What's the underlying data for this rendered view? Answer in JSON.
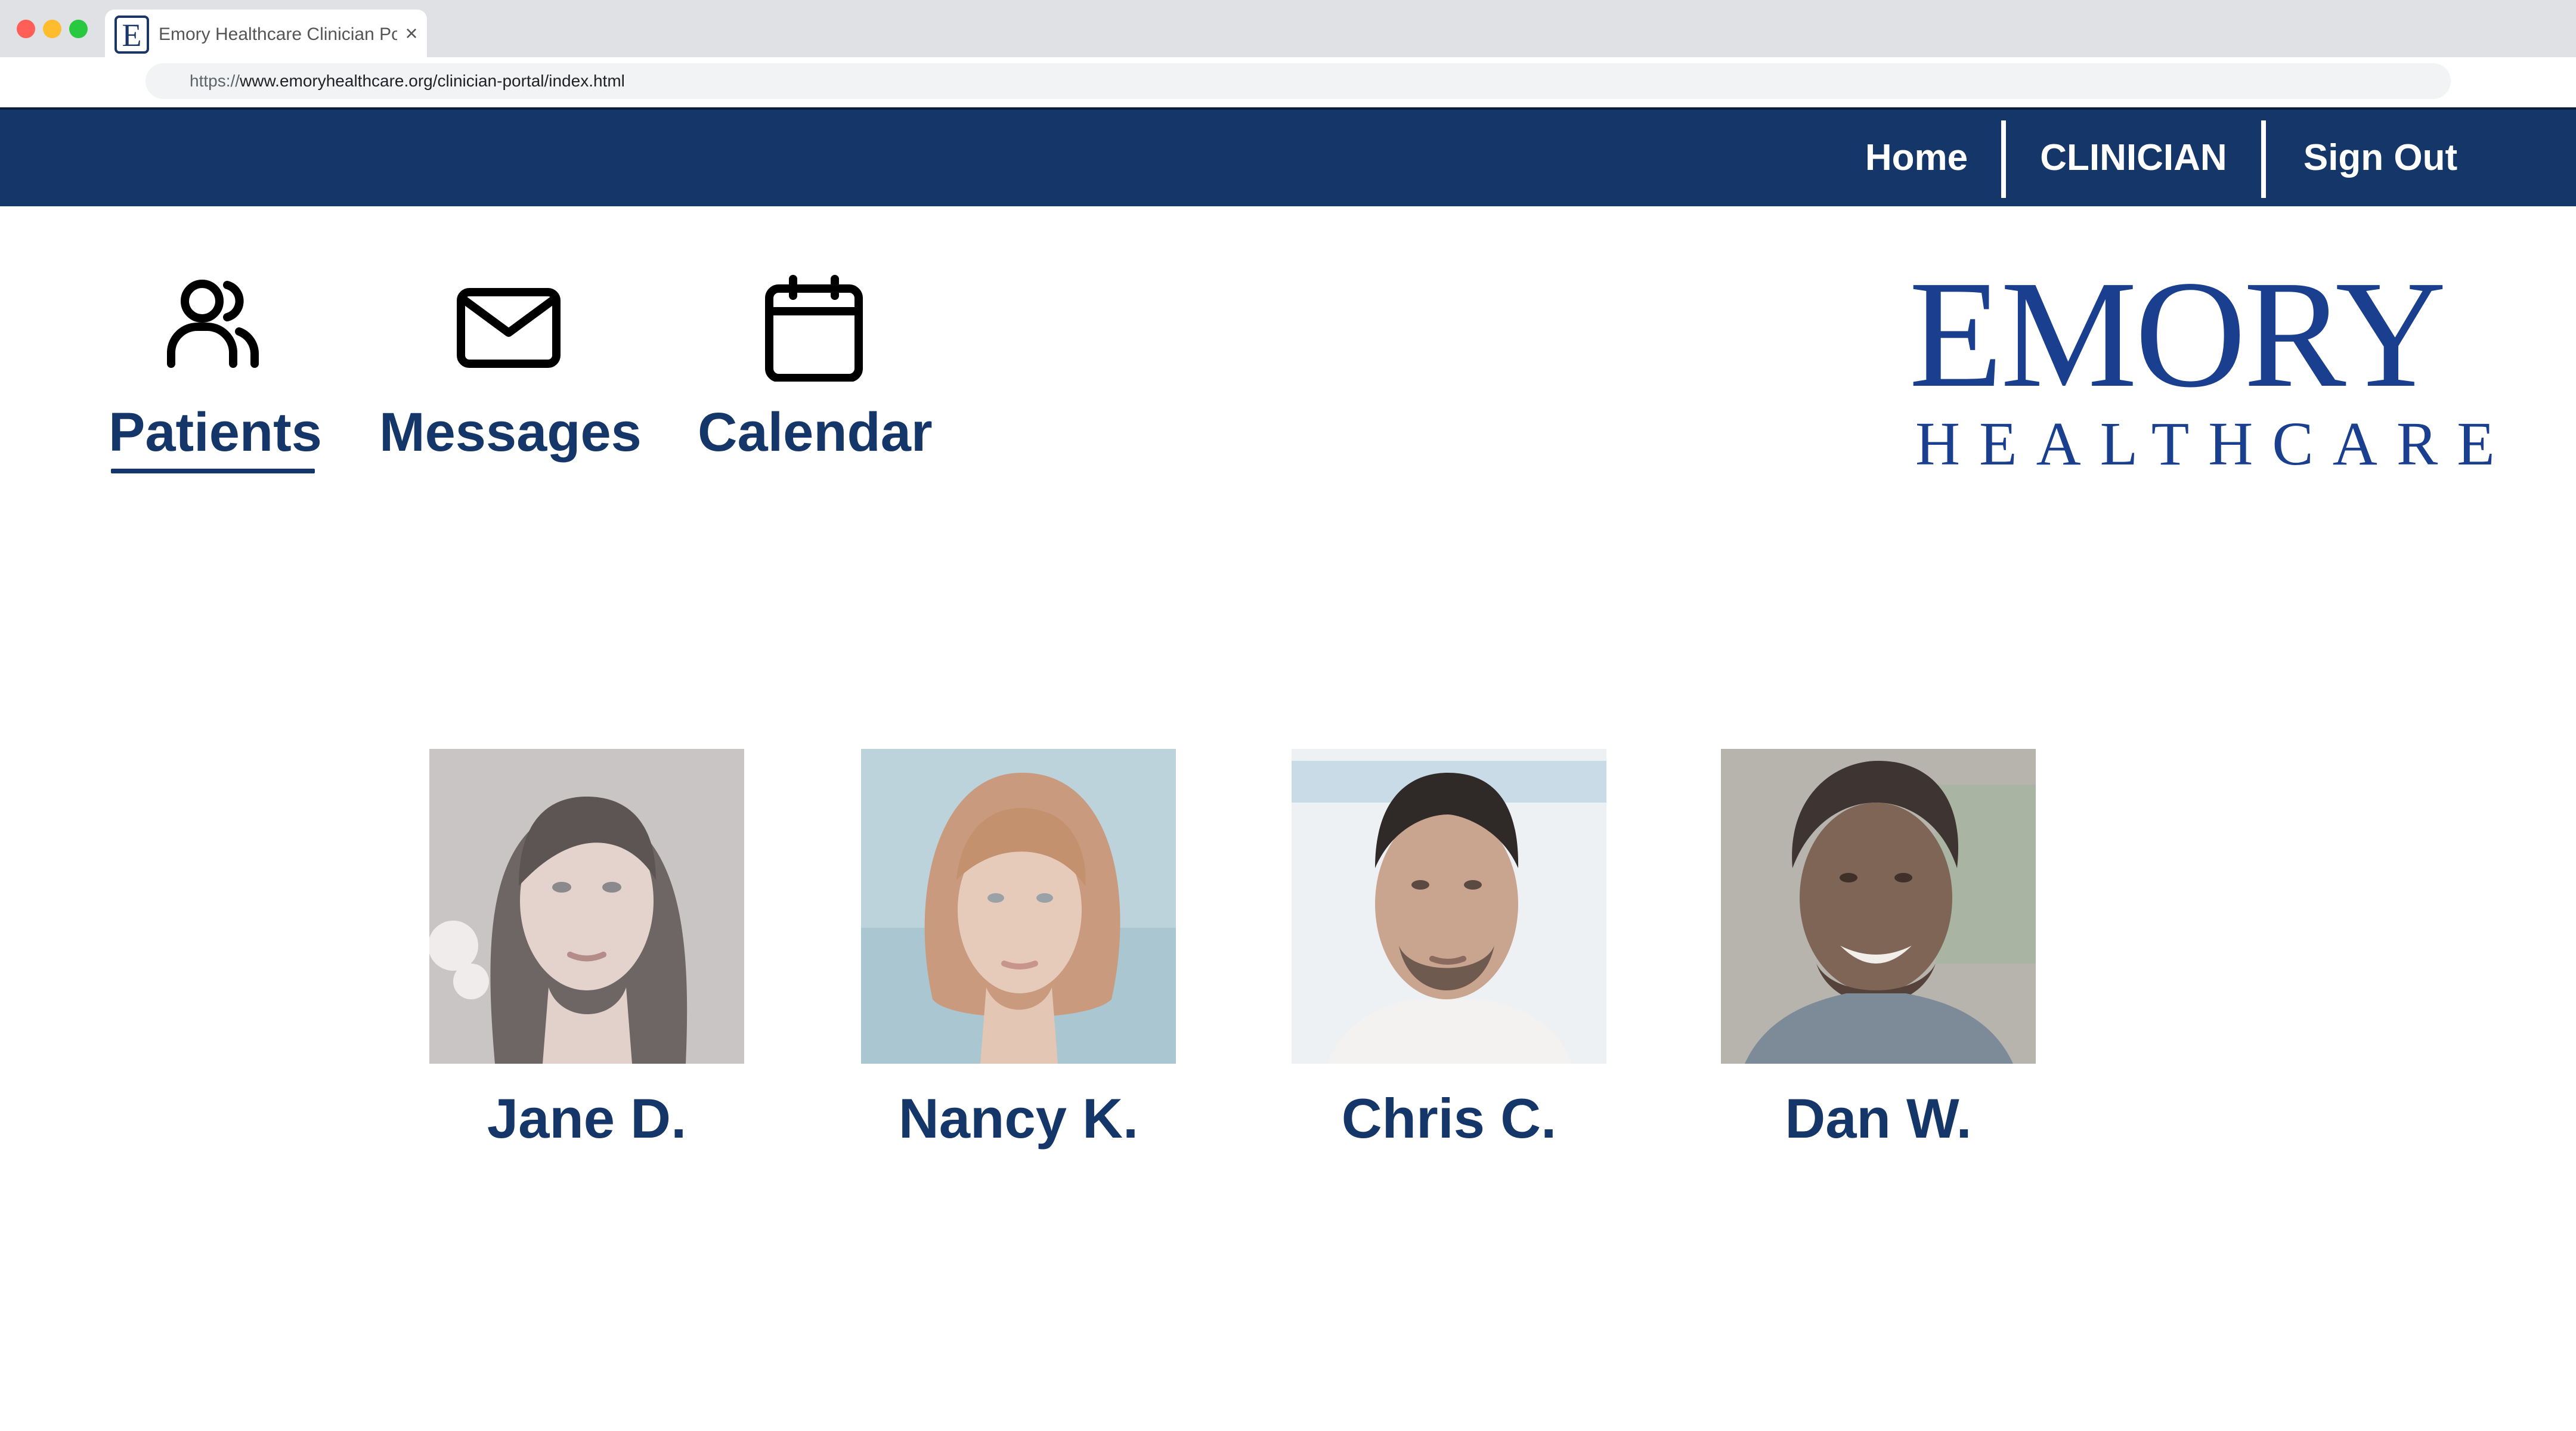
{
  "browser": {
    "tab_title": "Emory Healthcare Clinician Por",
    "favicon_letter": "E",
    "close_glyph": "×",
    "url_scheme": "https://",
    "url_rest": "www.emoryhealthcare.org/clinician-portal/index.html"
  },
  "nav": {
    "home": "Home",
    "clinician": "CLINICIAN",
    "sign_out": "Sign Out"
  },
  "sections": [
    {
      "label": "Patients",
      "icon": "users-icon",
      "active": true
    },
    {
      "label": "Messages",
      "icon": "mail-icon",
      "active": false
    },
    {
      "label": "Calendar",
      "icon": "calendar-icon",
      "active": false
    }
  ],
  "logo": {
    "top": "EMORY",
    "bottom": "HEALTHCARE"
  },
  "patients": [
    {
      "name": "Jane D."
    },
    {
      "name": "Nancy K."
    },
    {
      "name": "Chris C."
    },
    {
      "name": "Dan W."
    }
  ],
  "colors": {
    "navy": "#153668",
    "logo_blue": "#1a3f8f",
    "chrome_gray": "#dfe1e5"
  }
}
